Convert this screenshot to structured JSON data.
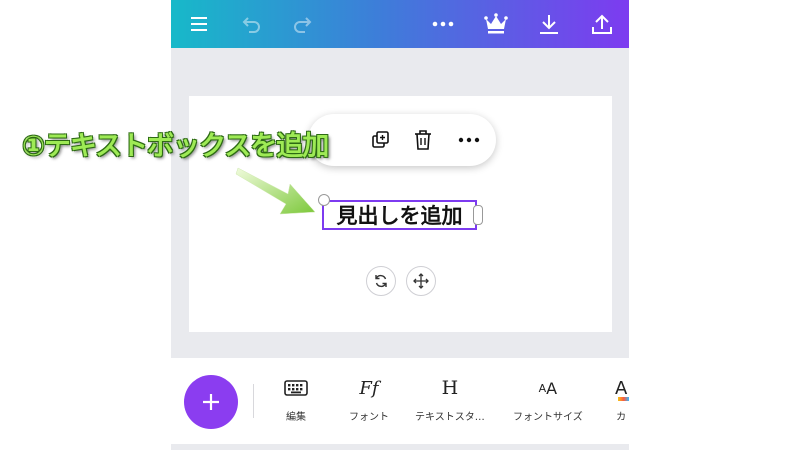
{
  "toolbar": {
    "icons": [
      "menu-icon",
      "undo-icon",
      "redo-icon",
      "more-icon",
      "crown-icon",
      "download-icon",
      "share-icon"
    ]
  },
  "context_menu": {
    "icons": [
      "duplicate-icon",
      "trash-icon",
      "more-icon"
    ]
  },
  "canvas": {
    "textbox_text": "見出しを追加"
  },
  "bottom_toolbar": {
    "tools": [
      {
        "label": "編集",
        "icon": "keyboard-icon"
      },
      {
        "label": "フォント",
        "icon": "font-icon",
        "glyph": "Ff"
      },
      {
        "label": "テキストスタ…",
        "icon": "heading-icon",
        "glyph": "H"
      },
      {
        "label": "フォントサイズ",
        "icon": "font-size-icon",
        "glyph": "AA"
      },
      {
        "label": "カ",
        "icon": "color-icon",
        "glyph": "A"
      }
    ]
  },
  "annotation": {
    "text": "①テキストボックスを追加"
  },
  "colors": {
    "accent": "#8b3df0",
    "gradient_start": "#17b9c9",
    "gradient_end": "#7d3bf0",
    "annotation_text": "#9eea55"
  }
}
